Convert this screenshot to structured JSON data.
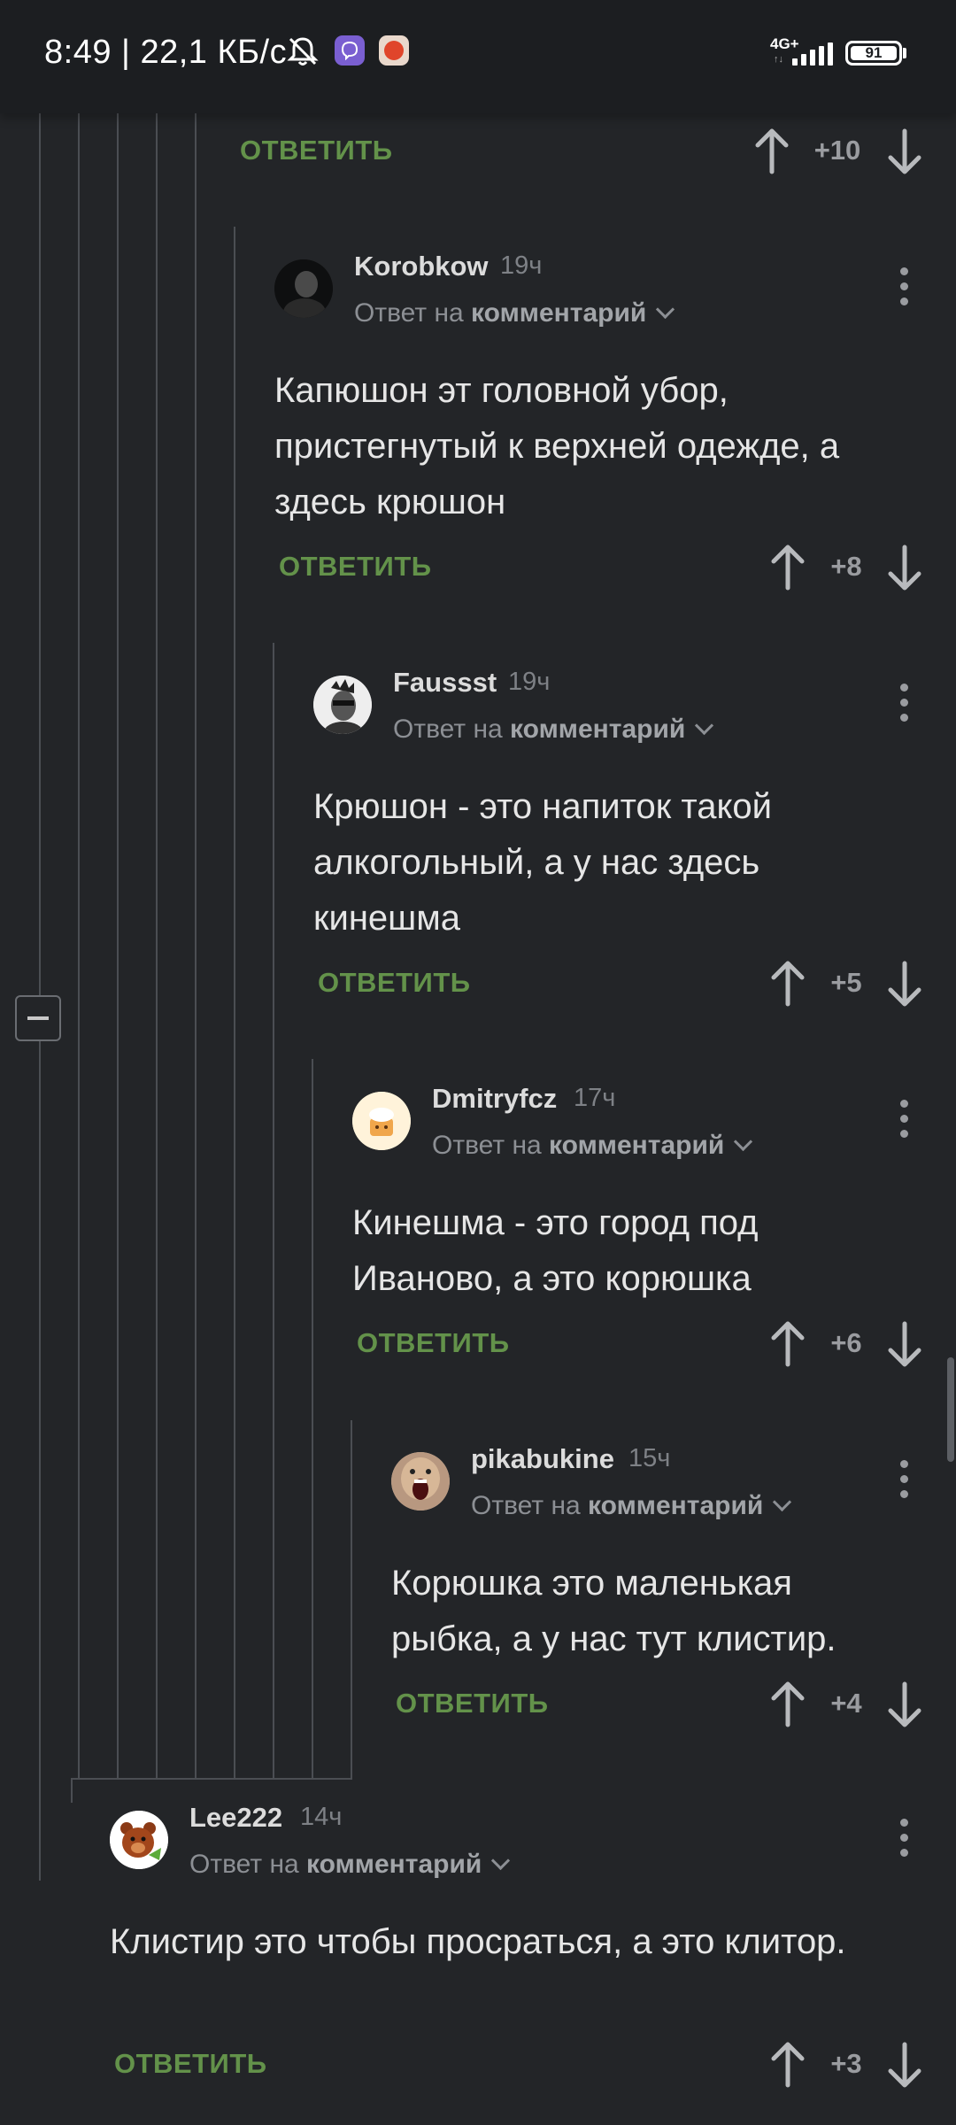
{
  "status_bar": {
    "time": "8:49 | 22,1 КБ/с",
    "network": "4G+",
    "battery": "91"
  },
  "top": {
    "reply": "ОТВЕТИТЬ",
    "score": "+10"
  },
  "comments": [
    {
      "username": "Korobkow",
      "time": "19ч",
      "reply_prefix": "Ответ на",
      "reply_target": "комментарий",
      "text": "Капюшон эт головной убор, пристегнутый к верхней одежде, а здесь крюшон",
      "reply": "ОТВЕТИТЬ",
      "score": "+8"
    },
    {
      "username": "Faussst",
      "time": "19ч",
      "reply_prefix": "Ответ на",
      "reply_target": "комментарий",
      "text": "Крюшон - это напиток такой алкогольный, а у нас здесь кинешма",
      "reply": "ОТВЕТИТЬ",
      "score": "+5"
    },
    {
      "username": "Dmitryfcz",
      "time": "17ч",
      "reply_prefix": "Ответ на",
      "reply_target": "комментарий",
      "text": "Кинешма - это город под Иваново, а это корюшка",
      "reply": "ОТВЕТИТЬ",
      "score": "+6"
    },
    {
      "username": "pikabukine",
      "time": "15ч",
      "reply_prefix": "Ответ на",
      "reply_target": "комментарий",
      "text": "Корюшка это маленькая рыбка, а у нас тут клистир.",
      "reply": "ОТВЕТИТЬ",
      "score": "+4"
    },
    {
      "username": "Lee222",
      "time": "14ч",
      "reply_prefix": "Ответ на",
      "reply_target": "комментарий",
      "text": "Клистир это чтобы просраться, а это клитор.",
      "reply": "ОТВЕТИТЬ",
      "score": "+3"
    }
  ],
  "icons": {
    "upvote": "arrow-up-icon",
    "downvote": "arrow-down-icon",
    "more": "more-vertical-icon",
    "collapse": "collapse-minus-icon"
  },
  "colors": {
    "background": "#232528",
    "reply_link": "#63924a",
    "thread_line": "#4b4e53"
  }
}
